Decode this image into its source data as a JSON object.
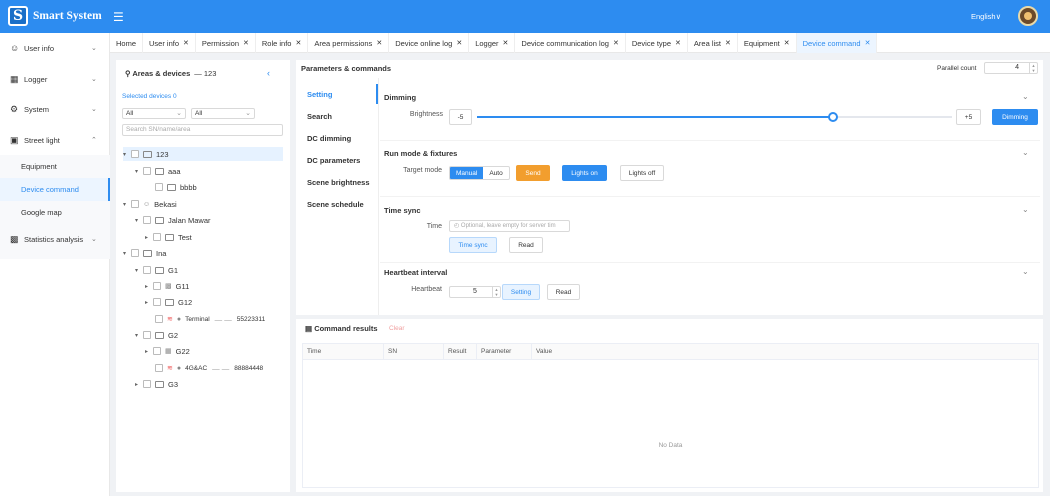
{
  "app": {
    "title": "Smart System",
    "logo_letter": "S",
    "language": "English",
    "language_caret": "∨"
  },
  "sidebar": {
    "items": [
      {
        "label": "User info",
        "icon": "user-icon"
      },
      {
        "label": "Logger",
        "icon": "calendar-icon"
      },
      {
        "label": "System",
        "icon": "settings-icon"
      },
      {
        "label": "Street light",
        "icon": "street-light-icon"
      },
      {
        "label": "Statistics analysis",
        "icon": "bar-chart-icon"
      }
    ],
    "subitems": [
      "Equipment",
      "Device command",
      "Google map"
    ]
  },
  "tabs": [
    {
      "label": "Home",
      "closable": false
    },
    {
      "label": "User info",
      "closable": true
    },
    {
      "label": "Permission",
      "closable": true
    },
    {
      "label": "Role info",
      "closable": true
    },
    {
      "label": "Area permissions",
      "closable": true
    },
    {
      "label": "Device online log",
      "closable": true
    },
    {
      "label": "Logger",
      "closable": true
    },
    {
      "label": "Device communication log",
      "closable": true
    },
    {
      "label": "Device type",
      "closable": true
    },
    {
      "label": "Area list",
      "closable": true
    },
    {
      "label": "Equipment",
      "closable": true
    },
    {
      "label": "Device command",
      "closable": true,
      "active": true
    }
  ],
  "tree": {
    "title": "Areas & devices",
    "count": "— 123",
    "selected_devices": "Selected devices 0",
    "filter1": "All",
    "filter2": "All",
    "search_placeholder": "Search SN/name/area",
    "nodes": [
      {
        "label": "123",
        "type": "folder"
      },
      {
        "label": "aaa",
        "type": "folder"
      },
      {
        "label": "bbbb",
        "type": "folder"
      },
      {
        "label": "Bekasi",
        "type": "user"
      },
      {
        "label": "Jalan Mawar",
        "type": "folder"
      },
      {
        "label": "Test",
        "type": "folder"
      },
      {
        "label": "Ina",
        "type": "folder"
      },
      {
        "label": "G1",
        "type": "folder"
      },
      {
        "label": "G11",
        "type": "chart"
      },
      {
        "label": "G12",
        "type": "folder"
      },
      {
        "label": "Terminal",
        "type": "device",
        "sn": "55223311"
      },
      {
        "label": "G2",
        "type": "folder"
      },
      {
        "label": "G22",
        "type": "building"
      },
      {
        "label": "4G&AC",
        "type": "device",
        "sn": "88884448"
      },
      {
        "label": "G3",
        "type": "folder"
      }
    ]
  },
  "params": {
    "title": "Parameters & commands",
    "parallel_label": "Parallel count",
    "parallel_value": "4",
    "menu": [
      "Setting",
      "Search",
      "DC dimming",
      "DC parameters",
      "Scene brightness",
      "Scene schedule"
    ],
    "dimming": {
      "title": "Dimming",
      "brightness_label": "Brightness",
      "minus": "-5",
      "plus": "+5",
      "button": "Dimming",
      "level": 0.75
    },
    "runmode": {
      "title": "Run mode & fixtures",
      "target_label": "Target mode",
      "modes": [
        "Manual",
        "Auto"
      ],
      "send": "Send",
      "lights_on": "Lights on",
      "lights_off": "Lights off"
    },
    "timesync": {
      "title": "Time sync",
      "time_label": "Time",
      "placeholder": "Optional, leave empty for server tim",
      "sync_button": "Time sync",
      "read_button": "Read"
    },
    "heartbeat": {
      "title": "Heartbeat interval",
      "label": "Heartbeat",
      "value": "5",
      "setting_button": "Setting",
      "read_button": "Read"
    }
  },
  "results": {
    "title": "Command results",
    "clear": "Clear",
    "columns": [
      "Time",
      "SN",
      "Result",
      "Parameter",
      "Value"
    ],
    "empty": "No Data"
  }
}
